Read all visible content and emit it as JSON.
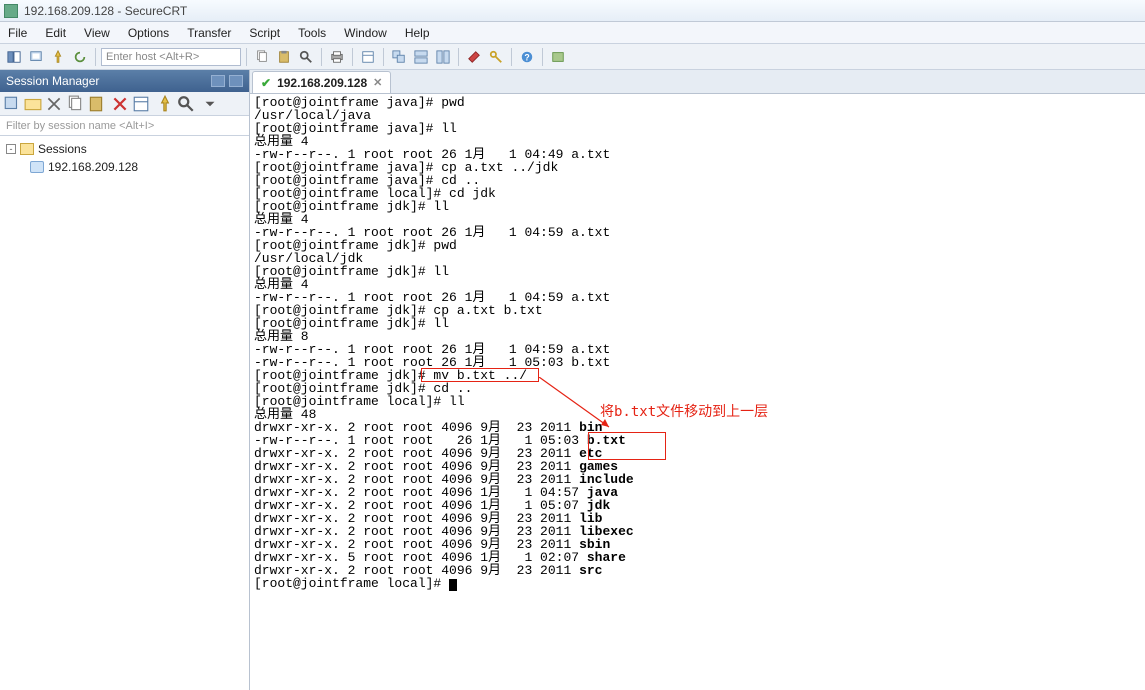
{
  "window": {
    "title": "192.168.209.128 - SecureCRT"
  },
  "menu": {
    "file": "File",
    "edit": "Edit",
    "view": "View",
    "options": "Options",
    "transfer": "Transfer",
    "script": "Script",
    "tools": "Tools",
    "window": "Window",
    "help": "Help"
  },
  "toolbar": {
    "host_placeholder": "Enter host <Alt+R>"
  },
  "session_manager": {
    "title": "Session Manager",
    "filter_placeholder": "Filter by session name <Alt+I>",
    "root": "Sessions",
    "items": [
      "192.168.209.128"
    ]
  },
  "tabs": [
    {
      "label": "192.168.209.128",
      "active": true
    }
  ],
  "terminal_lines": [
    "[root@jointframe java]# pwd",
    "/usr/local/java",
    "[root@jointframe java]# ll",
    "总用量 4",
    "-rw-r--r--. 1 root root 26 1月   1 04:49 a.txt",
    "[root@jointframe java]# cp a.txt ../jdk",
    "[root@jointframe java]# cd ..",
    "[root@jointframe local]# cd jdk",
    "[root@jointframe jdk]# ll",
    "总用量 4",
    "-rw-r--r--. 1 root root 26 1月   1 04:59 a.txt",
    "[root@jointframe jdk]# pwd",
    "/usr/local/jdk",
    "[root@jointframe jdk]# ll",
    "总用量 4",
    "-rw-r--r--. 1 root root 26 1月   1 04:59 a.txt",
    "[root@jointframe jdk]# cp a.txt b.txt",
    "[root@jointframe jdk]# ll",
    "总用量 8",
    "-rw-r--r--. 1 root root 26 1月   1 04:59 a.txt",
    "-rw-r--r--. 1 root root 26 1月   1 05:03 b.txt",
    "[root@jointframe jdk]# mv b.txt ../",
    "[root@jointframe jdk]# cd ..",
    "[root@jointframe local]# ll",
    "总用量 48",
    "drwxr-xr-x. 2 root root 4096 9月  23 2011 |bin|",
    "-rw-r--r--. 1 root root   26 1月   1 05:03 |b.txt|",
    "drwxr-xr-x. 2 root root 4096 9月  23 2011 |etc|",
    "drwxr-xr-x. 2 root root 4096 9月  23 2011 |games|",
    "drwxr-xr-x. 2 root root 4096 9月  23 2011 |include|",
    "drwxr-xr-x. 2 root root 4096 1月   1 04:57 |java|",
    "drwxr-xr-x. 2 root root 4096 1月   1 05:07 |jdk|",
    "drwxr-xr-x. 2 root root 4096 9月  23 2011 |lib|",
    "drwxr-xr-x. 2 root root 4096 9月  23 2011 |libexec|",
    "drwxr-xr-x. 2 root root 4096 9月  23 2011 |sbin|",
    "drwxr-xr-x. 5 root root 4096 1月   1 02:07 |share|",
    "drwxr-xr-x. 2 root root 4096 9月  23 2011 |src|",
    "[root@jointframe local]# "
  ],
  "annotation": {
    "text": "将b.txt文件移动到上一层"
  }
}
